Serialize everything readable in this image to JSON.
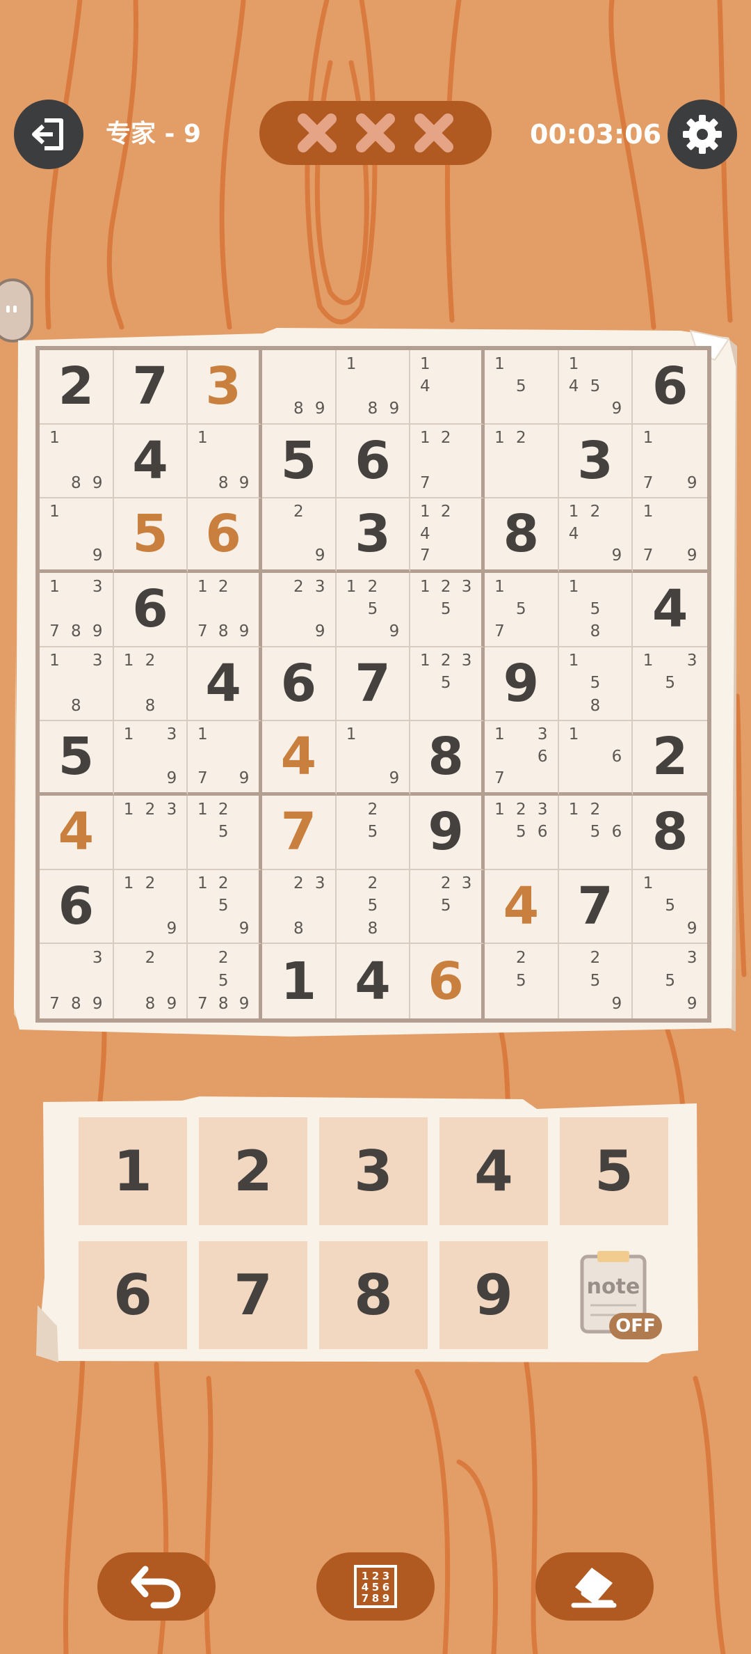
{
  "header": {
    "level_label": "专家 - 9",
    "timer": "00:03:06",
    "mistakes_max": 3,
    "mistakes_made": 0
  },
  "colors": {
    "background": "#e39d66",
    "accent_dark": "#b05a22",
    "given_digit": "#45413f",
    "user_digit": "#c9803f",
    "cell_bg": "#f8f0e6",
    "keypad_bg": "#f2d8c1"
  },
  "board": {
    "rows": [
      [
        {
          "v": "2",
          "user": false
        },
        {
          "v": "7",
          "user": false
        },
        {
          "v": "3",
          "user": true
        },
        {
          "n": [
            8,
            9
          ]
        },
        {
          "n": [
            1,
            8,
            9
          ]
        },
        {
          "n": [
            1,
            4
          ]
        },
        {
          "n": [
            1,
            5
          ]
        },
        {
          "n": [
            1,
            4,
            5,
            9
          ]
        },
        {
          "v": "6",
          "user": false
        }
      ],
      [
        {
          "n": [
            1,
            8,
            9
          ]
        },
        {
          "v": "4",
          "user": false
        },
        {
          "n": [
            1,
            8,
            9
          ]
        },
        {
          "v": "5",
          "user": false
        },
        {
          "v": "6",
          "user": false
        },
        {
          "n": [
            1,
            2,
            7
          ]
        },
        {
          "n": [
            1,
            2
          ]
        },
        {
          "v": "3",
          "user": false
        },
        {
          "n": [
            1,
            7,
            9
          ]
        }
      ],
      [
        {
          "n": [
            1,
            9
          ]
        },
        {
          "v": "5",
          "user": true
        },
        {
          "v": "6",
          "user": true
        },
        {
          "n": [
            2,
            9
          ]
        },
        {
          "v": "3",
          "user": false
        },
        {
          "n": [
            1,
            2,
            4,
            7
          ]
        },
        {
          "v": "8",
          "user": false
        },
        {
          "n": [
            1,
            2,
            4,
            9
          ]
        },
        {
          "n": [
            1,
            7,
            9
          ]
        }
      ],
      [
        {
          "n": [
            1,
            3,
            7,
            8,
            9
          ]
        },
        {
          "v": "6",
          "user": false
        },
        {
          "n": [
            1,
            2,
            7,
            8,
            9
          ]
        },
        {
          "n": [
            2,
            3,
            9
          ]
        },
        {
          "n": [
            1,
            2,
            5,
            9
          ]
        },
        {
          "n": [
            1,
            2,
            3,
            5
          ]
        },
        {
          "n": [
            1,
            5,
            7
          ]
        },
        {
          "n": [
            1,
            5,
            8
          ]
        },
        {
          "v": "4",
          "user": false
        }
      ],
      [
        {
          "n": [
            1,
            3,
            8
          ]
        },
        {
          "n": [
            1,
            2,
            8
          ]
        },
        {
          "v": "4",
          "user": false
        },
        {
          "v": "6",
          "user": false
        },
        {
          "v": "7",
          "user": false
        },
        {
          "n": [
            1,
            2,
            3,
            5
          ]
        },
        {
          "v": "9",
          "user": false
        },
        {
          "n": [
            1,
            5,
            8
          ]
        },
        {
          "n": [
            1,
            3,
            5
          ]
        }
      ],
      [
        {
          "v": "5",
          "user": false
        },
        {
          "n": [
            1,
            3,
            9
          ]
        },
        {
          "n": [
            1,
            7,
            9
          ]
        },
        {
          "v": "4",
          "user": true
        },
        {
          "n": [
            1,
            9
          ]
        },
        {
          "v": "8",
          "user": false
        },
        {
          "n": [
            1,
            3,
            6,
            7
          ]
        },
        {
          "n": [
            1,
            6
          ]
        },
        {
          "v": "2",
          "user": false
        }
      ],
      [
        {
          "v": "4",
          "user": true
        },
        {
          "n": [
            1,
            2,
            3
          ]
        },
        {
          "n": [
            1,
            2,
            5
          ]
        },
        {
          "v": "7",
          "user": true
        },
        {
          "n": [
            2,
            5
          ]
        },
        {
          "v": "9",
          "user": false
        },
        {
          "n": [
            1,
            2,
            3,
            5,
            6
          ]
        },
        {
          "n": [
            1,
            2,
            5,
            6
          ]
        },
        {
          "v": "8",
          "user": false
        }
      ],
      [
        {
          "v": "6",
          "user": false
        },
        {
          "n": [
            1,
            2,
            9
          ]
        },
        {
          "n": [
            1,
            2,
            5,
            9
          ]
        },
        {
          "n": [
            2,
            3,
            8
          ]
        },
        {
          "n": [
            2,
            5,
            8
          ]
        },
        {
          "n": [
            2,
            3,
            5
          ]
        },
        {
          "v": "4",
          "user": true
        },
        {
          "v": "7",
          "user": false
        },
        {
          "n": [
            1,
            5,
            9
          ]
        }
      ],
      [
        {
          "n": [
            3,
            7,
            8,
            9
          ]
        },
        {
          "n": [
            2,
            8,
            9
          ]
        },
        {
          "n": [
            2,
            5,
            7,
            8,
            9
          ]
        },
        {
          "v": "1",
          "user": false
        },
        {
          "v": "4",
          "user": false
        },
        {
          "v": "6",
          "user": true
        },
        {
          "n": [
            2,
            5
          ]
        },
        {
          "n": [
            2,
            5,
            9
          ]
        },
        {
          "n": [
            3,
            5,
            9
          ]
        }
      ]
    ]
  },
  "keypad": {
    "digits": [
      "1",
      "2",
      "3",
      "4",
      "5",
      "6",
      "7",
      "8",
      "9"
    ],
    "note_label": "note",
    "note_state": "OFF"
  },
  "icons": {
    "exit": "exit-icon",
    "settings": "gear-icon",
    "mistake": "x-mark-icon",
    "undo": "undo-icon",
    "hint": "number-grid-icon",
    "erase": "eraser-icon",
    "note": "clipboard-note-icon"
  }
}
